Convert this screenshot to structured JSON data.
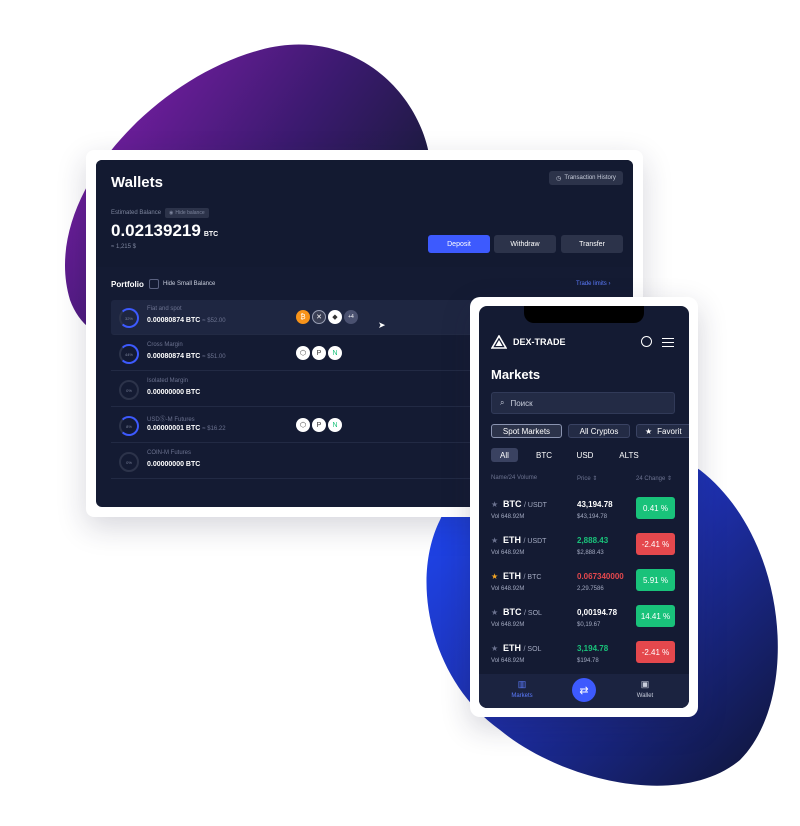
{
  "wallet": {
    "title": "Wallets",
    "tx_history": "Transaction History",
    "estimated_label": "Estimated Balance",
    "hide_label": "Hide balance",
    "balance": "0.02139219",
    "balance_unit": "BTC",
    "balance_usd": "≈ 1,215 $",
    "deposit": "Deposit",
    "withdraw": "Withdraw",
    "transfer": "Transfer",
    "portfolio": "Portfolio",
    "hide_small": "Hide Small Balance",
    "trade_limits": "Trade limits  ›",
    "rows": [
      {
        "name": "Fiat and spot",
        "pct": "32%",
        "value": "0.00080874 BTC",
        "usd": "≈ $52.00"
      },
      {
        "name": "Cross Margin",
        "pct": "44%",
        "value": "0.00080874 BTC",
        "usd": "≈ $51.00"
      },
      {
        "name": "Isolated Margin",
        "pct": "0%",
        "value": "0.00000000 BTC",
        "usd": ""
      },
      {
        "name": "USDⓈ-M Futures",
        "pct": "8%",
        "value": "0.00000001 BTC",
        "usd": "≈ $16.22"
      },
      {
        "name": "COIN-M Futures",
        "pct": "0%",
        "value": "0.00000000 BTC",
        "usd": ""
      }
    ],
    "more_badge": "+4"
  },
  "phone": {
    "brand": "DEX-TRADE",
    "title": "Markets",
    "search_placeholder": "Поиск",
    "chips": [
      "Spot Markets",
      "All Cryptos",
      "Favorit"
    ],
    "tabs": [
      "All",
      "BTC",
      "USD",
      "ALTS"
    ],
    "headers": {
      "name": "Name/24 Volume",
      "price": "Price ⇕",
      "change": "24 Change ⇕"
    },
    "markets": [
      {
        "base": "BTC",
        "quote": "/ USDT",
        "vol": "Vol 648.92M",
        "price": "43,194.78",
        "price_color": "#ffffff",
        "sub": "$43,194.78",
        "change": "0.41 %",
        "dir": "up",
        "fav": false
      },
      {
        "base": "ETH",
        "quote": "/ USDT",
        "vol": "Vol 648.92M",
        "price": "2,888.43",
        "price_color": "#19c27a",
        "sub": "$2,888.43",
        "change": "-2.41 %",
        "dir": "dn",
        "fav": false
      },
      {
        "base": "ETH",
        "quote": "/ BTC",
        "vol": "Vol 648.92M",
        "price": "0.067340000",
        "price_color": "#e5484d",
        "sub": "2,29.7586",
        "change": "5.91 %",
        "dir": "up",
        "fav": true
      },
      {
        "base": "BTC",
        "quote": "/ SOL",
        "vol": "Vol 648.92M",
        "price": "0,00194.78",
        "price_color": "#ffffff",
        "sub": "$0,19.67",
        "change": "14.41 %",
        "dir": "up",
        "fav": false
      },
      {
        "base": "ETH",
        "quote": "/ SOL",
        "vol": "Vol 648.92M",
        "price": "3,194.78",
        "price_color": "#19c27a",
        "sub": "$194.78",
        "change": "-2.41 %",
        "dir": "dn",
        "fav": false
      }
    ],
    "nav": {
      "markets": "Markets",
      "wallet": "Wallet"
    }
  },
  "colors": {
    "accent": "#3d5afe",
    "up": "#19c27a",
    "down": "#e5484d",
    "panel": "#141b33"
  }
}
